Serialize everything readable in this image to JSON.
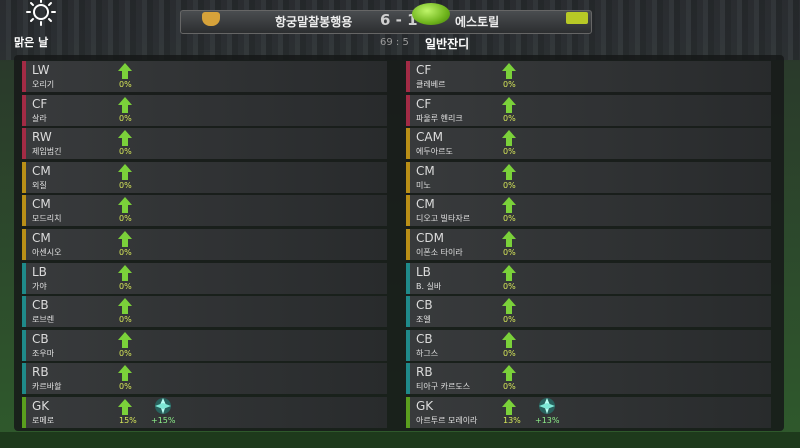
{
  "weather": {
    "icon": "sun-icon",
    "label": "맑은 날"
  },
  "match": {
    "home_team": "항궁말찰봉행용",
    "away_team": "에스토릴",
    "score": "6 - 1",
    "time": "69 : 5",
    "turf": "일반잔디"
  },
  "colors": {
    "forward": "#a22b45",
    "midfield": "#b98f17",
    "defense": "#1f8a8a",
    "keeper": "#5a9e1e",
    "arrow": "#7bd13a"
  },
  "home_players": [
    {
      "pos": "LW",
      "name": "오리기",
      "pct": "0%",
      "line": "forward"
    },
    {
      "pos": "CF",
      "name": "살라",
      "pct": "0%",
      "line": "forward"
    },
    {
      "pos": "RW",
      "name": "제임범긴",
      "pct": "0%",
      "line": "forward"
    },
    {
      "pos": "CM",
      "name": "외질",
      "pct": "0%",
      "line": "midfield"
    },
    {
      "pos": "CM",
      "name": "모드리치",
      "pct": "0%",
      "line": "midfield"
    },
    {
      "pos": "CM",
      "name": "아센시오",
      "pct": "0%",
      "line": "midfield"
    },
    {
      "pos": "LB",
      "name": "가야",
      "pct": "0%",
      "line": "defense"
    },
    {
      "pos": "CB",
      "name": "로브렌",
      "pct": "0%",
      "line": "defense"
    },
    {
      "pos": "CB",
      "name": "조우마",
      "pct": "0%",
      "line": "defense"
    },
    {
      "pos": "RB",
      "name": "카르바할",
      "pct": "0%",
      "line": "defense"
    },
    {
      "pos": "GK",
      "name": "로메로",
      "pct": "15%",
      "line": "keeper",
      "bonus": "+15%"
    }
  ],
  "away_players": [
    {
      "pos": "CF",
      "name": "클레베르",
      "pct": "0%",
      "line": "forward"
    },
    {
      "pos": "CF",
      "name": "파울루 헨리크",
      "pct": "0%",
      "line": "forward"
    },
    {
      "pos": "CAM",
      "name": "에두아르도",
      "pct": "0%",
      "line": "midfield"
    },
    {
      "pos": "CM",
      "name": "미노",
      "pct": "0%",
      "line": "midfield"
    },
    {
      "pos": "CM",
      "name": "디오고 빌타자르",
      "pct": "0%",
      "line": "midfield"
    },
    {
      "pos": "CDM",
      "name": "이폰소 타이라",
      "pct": "0%",
      "line": "midfield"
    },
    {
      "pos": "LB",
      "name": "B. 실바",
      "pct": "0%",
      "line": "defense"
    },
    {
      "pos": "CB",
      "name": "조엘",
      "pct": "0%",
      "line": "defense"
    },
    {
      "pos": "CB",
      "name": "하그스",
      "pct": "0%",
      "line": "defense"
    },
    {
      "pos": "RB",
      "name": "티아구 카르도스",
      "pct": "0%",
      "line": "defense"
    },
    {
      "pos": "GK",
      "name": "아르투르 모레이라",
      "pct": "13%",
      "line": "keeper",
      "bonus": "+13%"
    }
  ]
}
